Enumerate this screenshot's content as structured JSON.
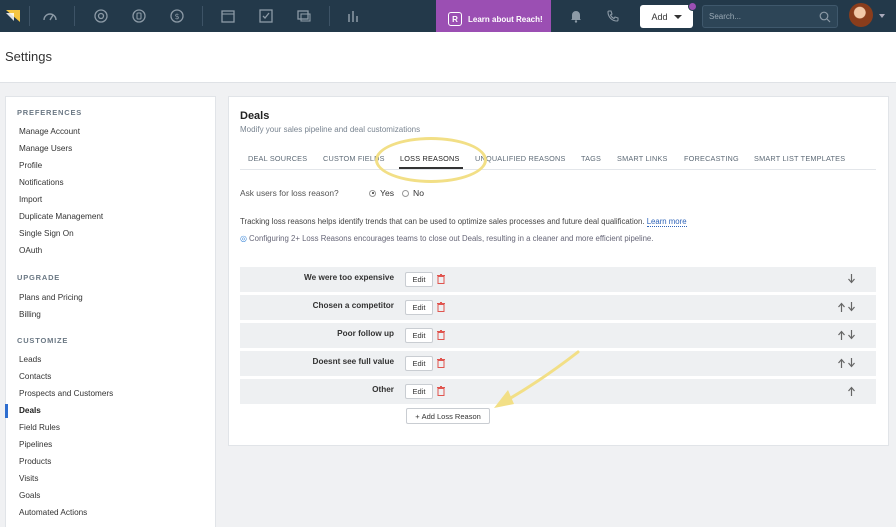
{
  "topnav": {
    "reach_label": "Learn about Reach!",
    "reach_badge": "R",
    "add_label": "Add",
    "search_placeholder": "Search..."
  },
  "header": {
    "title": "Settings"
  },
  "sidebar": {
    "sections": [
      {
        "title": "PREFERENCES",
        "items": [
          "Manage Account",
          "Manage Users",
          "Profile",
          "Notifications",
          "Import",
          "Duplicate Management",
          "Single Sign On",
          "OAuth"
        ]
      },
      {
        "title": "UPGRADE",
        "items": [
          "Plans and Pricing",
          "Billing"
        ]
      },
      {
        "title": "CUSTOMIZE",
        "items": [
          "Leads",
          "Contacts",
          "Prospects and Customers",
          "Deals",
          "Field Rules",
          "Pipelines",
          "Products",
          "Visits",
          "Goals",
          "Automated Actions"
        ]
      }
    ],
    "active_item": "Deals"
  },
  "main": {
    "title": "Deals",
    "subtitle": "Modify your sales pipeline and deal customizations",
    "tabs": [
      "DEAL SOURCES",
      "CUSTOM FIELDS",
      "LOSS REASONS",
      "UNQUALIFIED REASONS",
      "TAGS",
      "SMART LINKS",
      "FORECASTING",
      "SMART LIST TEMPLATES"
    ],
    "active_tab": "LOSS REASONS",
    "ask_label": "Ask users for loss reason?",
    "yes_label": "Yes",
    "no_label": "No",
    "selected_option": "Yes",
    "info_text": "Tracking loss reasons helps identify trends that can be used to optimize sales processes and future deal qualification.",
    "learn_more": "Learn more",
    "tip_text": "Configuring 2+ Loss Reasons encourages teams to close out Deals, resulting in a cleaner and more efficient pipeline.",
    "edit_label": "Edit",
    "add_reason_label": "Add Loss Reason",
    "reasons": [
      {
        "label": "We were too expensive",
        "up": false,
        "down": true
      },
      {
        "label": "Chosen a competitor",
        "up": true,
        "down": true
      },
      {
        "label": "Poor follow up",
        "up": true,
        "down": true
      },
      {
        "label": "Doesnt see full value",
        "up": true,
        "down": true
      },
      {
        "label": "Other",
        "up": true,
        "down": false
      }
    ]
  },
  "colors": {
    "nav_bg": "#23394a",
    "reach_purple": "#9b4fb3",
    "highlight_yellow": "#f2df86",
    "link_blue": "#2e63b8",
    "active_blue": "#2f6ecf",
    "trash_red": "#e0554f"
  }
}
